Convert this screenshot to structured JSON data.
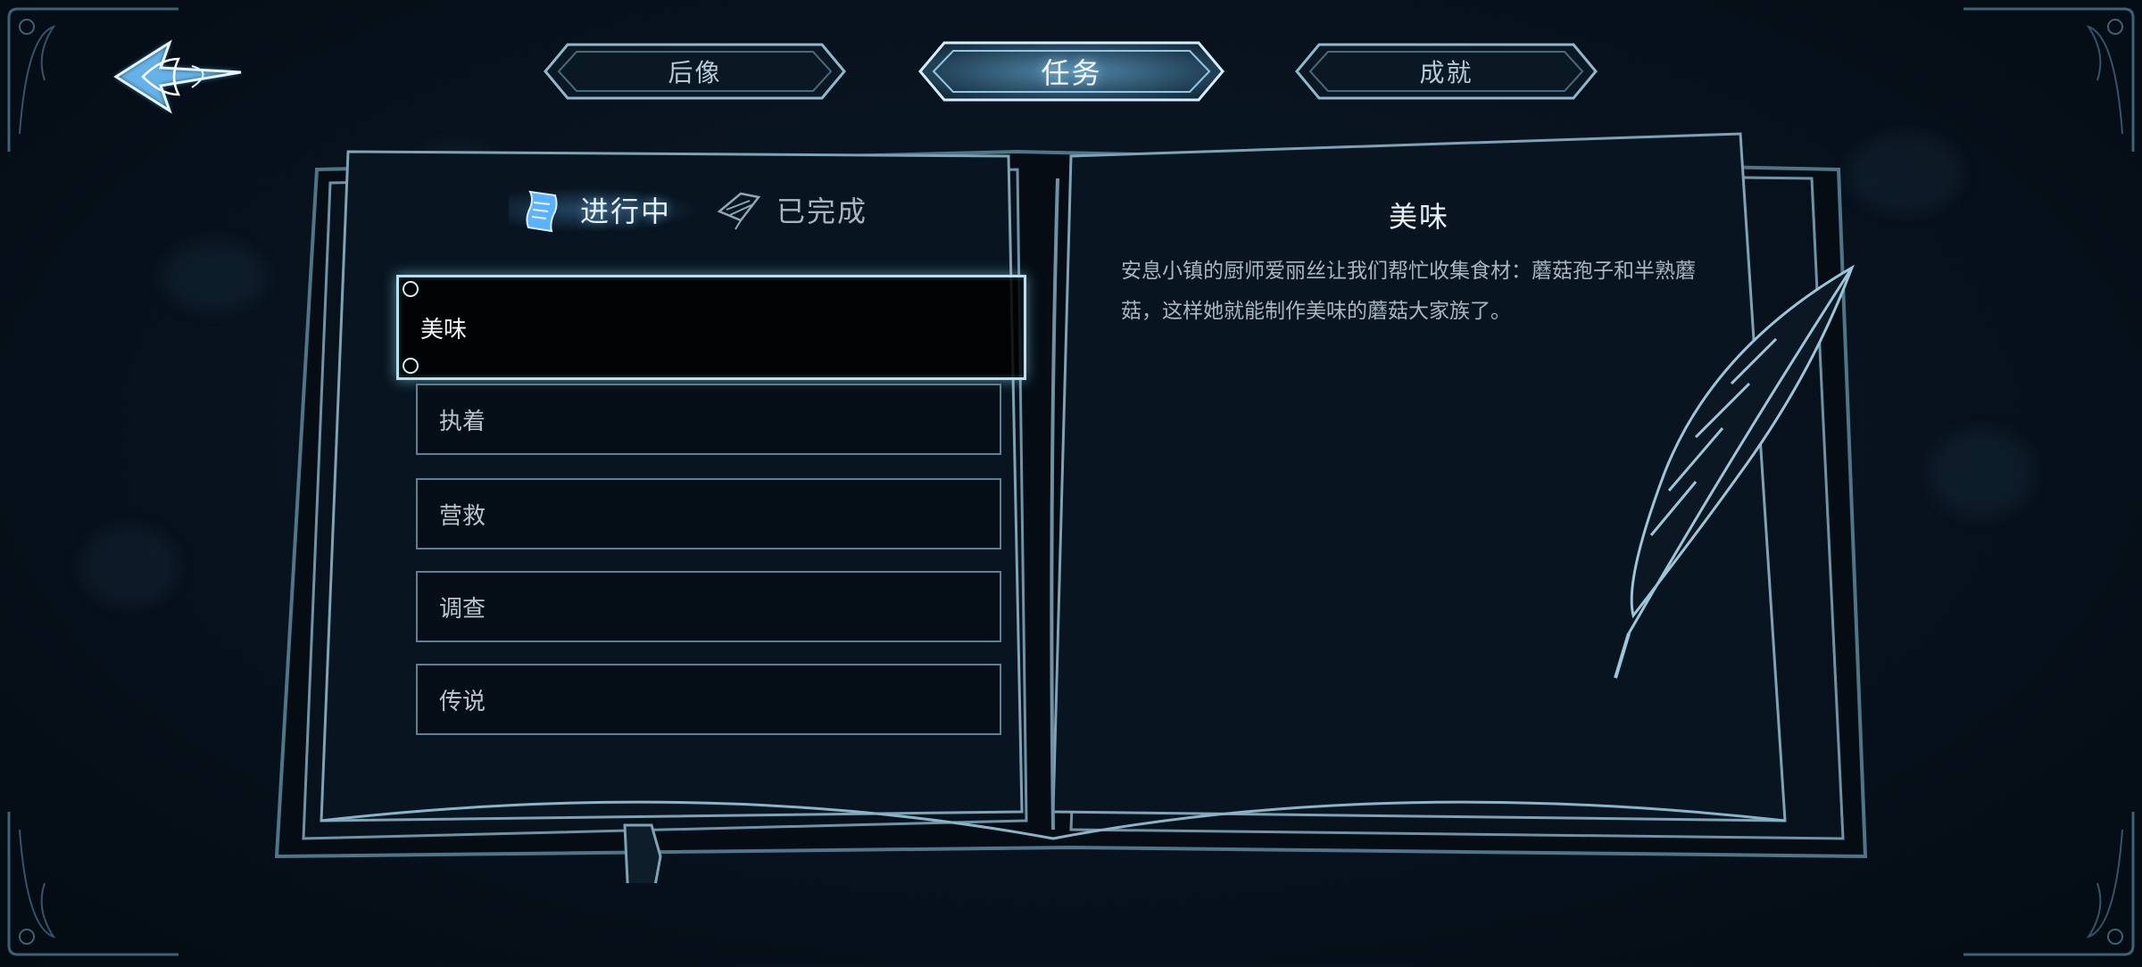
{
  "top_tabs": [
    {
      "label": "后像",
      "active": false
    },
    {
      "label": "任务",
      "active": true
    },
    {
      "label": "成就",
      "active": false
    }
  ],
  "quest_tabs": {
    "ongoing": "进行中",
    "completed": "已完成"
  },
  "quests": [
    {
      "title": "美味",
      "selected": true
    },
    {
      "title": "执着",
      "selected": false
    },
    {
      "title": "营救",
      "selected": false
    },
    {
      "title": "调查",
      "selected": false
    },
    {
      "title": "传说",
      "selected": false
    }
  ],
  "detail": {
    "title": "美味",
    "description": "安息小镇的厨师爱丽丝让我们帮忙收集食材：蘑菇孢子和半熟蘑菇，这样她就能制作美味的蘑菇大家族了。"
  },
  "icons": {
    "back": "ornate-arrow-left-icon",
    "ongoing": "scroll-icon",
    "completed": "quill-feather-icon"
  },
  "colors": {
    "accent_glow": "#8fd0ff",
    "outline": "#5f7f92",
    "background": "#07121d"
  }
}
